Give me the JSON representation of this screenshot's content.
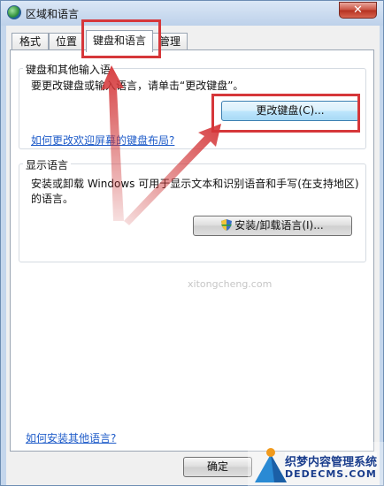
{
  "window": {
    "title": "区域和语言",
    "close_glyph": "✕"
  },
  "tabs": [
    {
      "label": "格式"
    },
    {
      "label": "位置"
    },
    {
      "label": "键盘和语言"
    },
    {
      "label": "管理"
    }
  ],
  "keyboard_group": {
    "label": "键盘和其他输入语",
    "description": "要更改键盘或输入语言，请单击“更改键盘”。",
    "button": "更改键盘(C)...",
    "link": "如何更改欢迎屏幕的键盘布局?"
  },
  "display_group": {
    "label": "显示语言",
    "description": "安装或卸载 Windows 可用于显示文本和识别语音和手写(在支持地区)的语言。",
    "button": "安装/卸载语言(I)..."
  },
  "footer": {
    "link": "如何安装其他语言?",
    "ok_button": "确定"
  },
  "watermark": {
    "site": "xitongcheng.com",
    "brand_line1": "织梦内容管理系统",
    "brand_line2": "DEDECMS.COM"
  },
  "colors": {
    "annotation_red": "#d6373a",
    "link_blue": "#1f5cc9"
  },
  "icons": {
    "title": "globe-icon",
    "shield": "uac-shield-icon",
    "close": "close-icon"
  }
}
